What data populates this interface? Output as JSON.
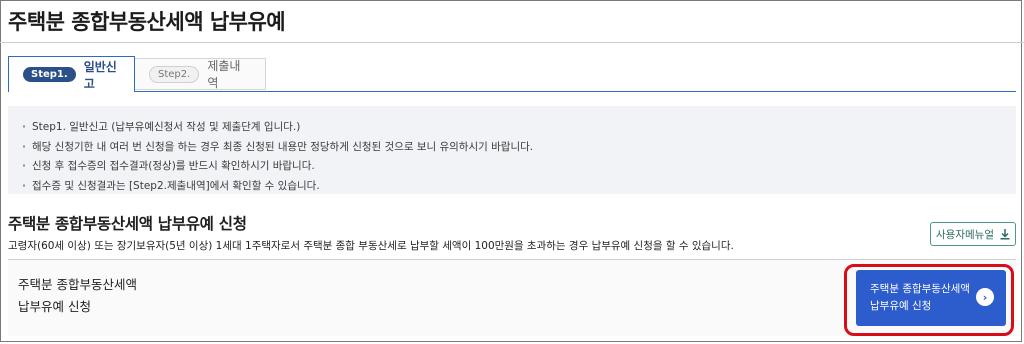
{
  "page": {
    "title": "주택분 종합부동산세액 납부유예"
  },
  "tabs": [
    {
      "step": "Step1.",
      "label": "일반신고",
      "active": true
    },
    {
      "step": "Step2.",
      "label": "제출내역",
      "active": false
    }
  ],
  "notice": {
    "items": [
      "Step1. 일반신고 (납부유예신청서 작성 및 제출단계 입니다.)",
      "해당 신청기한 내 여러 번 신청을 하는 경우 최종 신청된 내용만 정당하게 신청된 것으로 보니 유의하시기 바랍니다.",
      "신청 후 접수증의 접수결과(정상)를 반드시 확인하시기 바랍니다.",
      "접수증 및 신청결과는 [Step2.제출내역]에서 확인할 수 있습니다."
    ]
  },
  "section": {
    "title": "주택분 종합부동산세액 납부유예 신청",
    "description": "고령자(60세 이상) 또는 장기보유자(5년 이상) 1세대 1주택자로서 주택분 종합 부동산세로 납부할 세액이 100만원을 초과하는 경우 납부유예 신청을 할 수 있습니다.",
    "manual_button": "사용자메뉴얼",
    "service_name_line1": "주택분 종합부동산세액",
    "service_name_line2": "납부유예 신청",
    "apply_button_line1": "주택분 종합부동산세액",
    "apply_button_line2": "납부유예 신청"
  },
  "colors": {
    "accent": "#2d5ccc",
    "highlight": "#d90c1a",
    "step_active": "#2b4f87"
  },
  "icons": {
    "manual": "download-icon",
    "apply": "chevron-right-icon"
  }
}
